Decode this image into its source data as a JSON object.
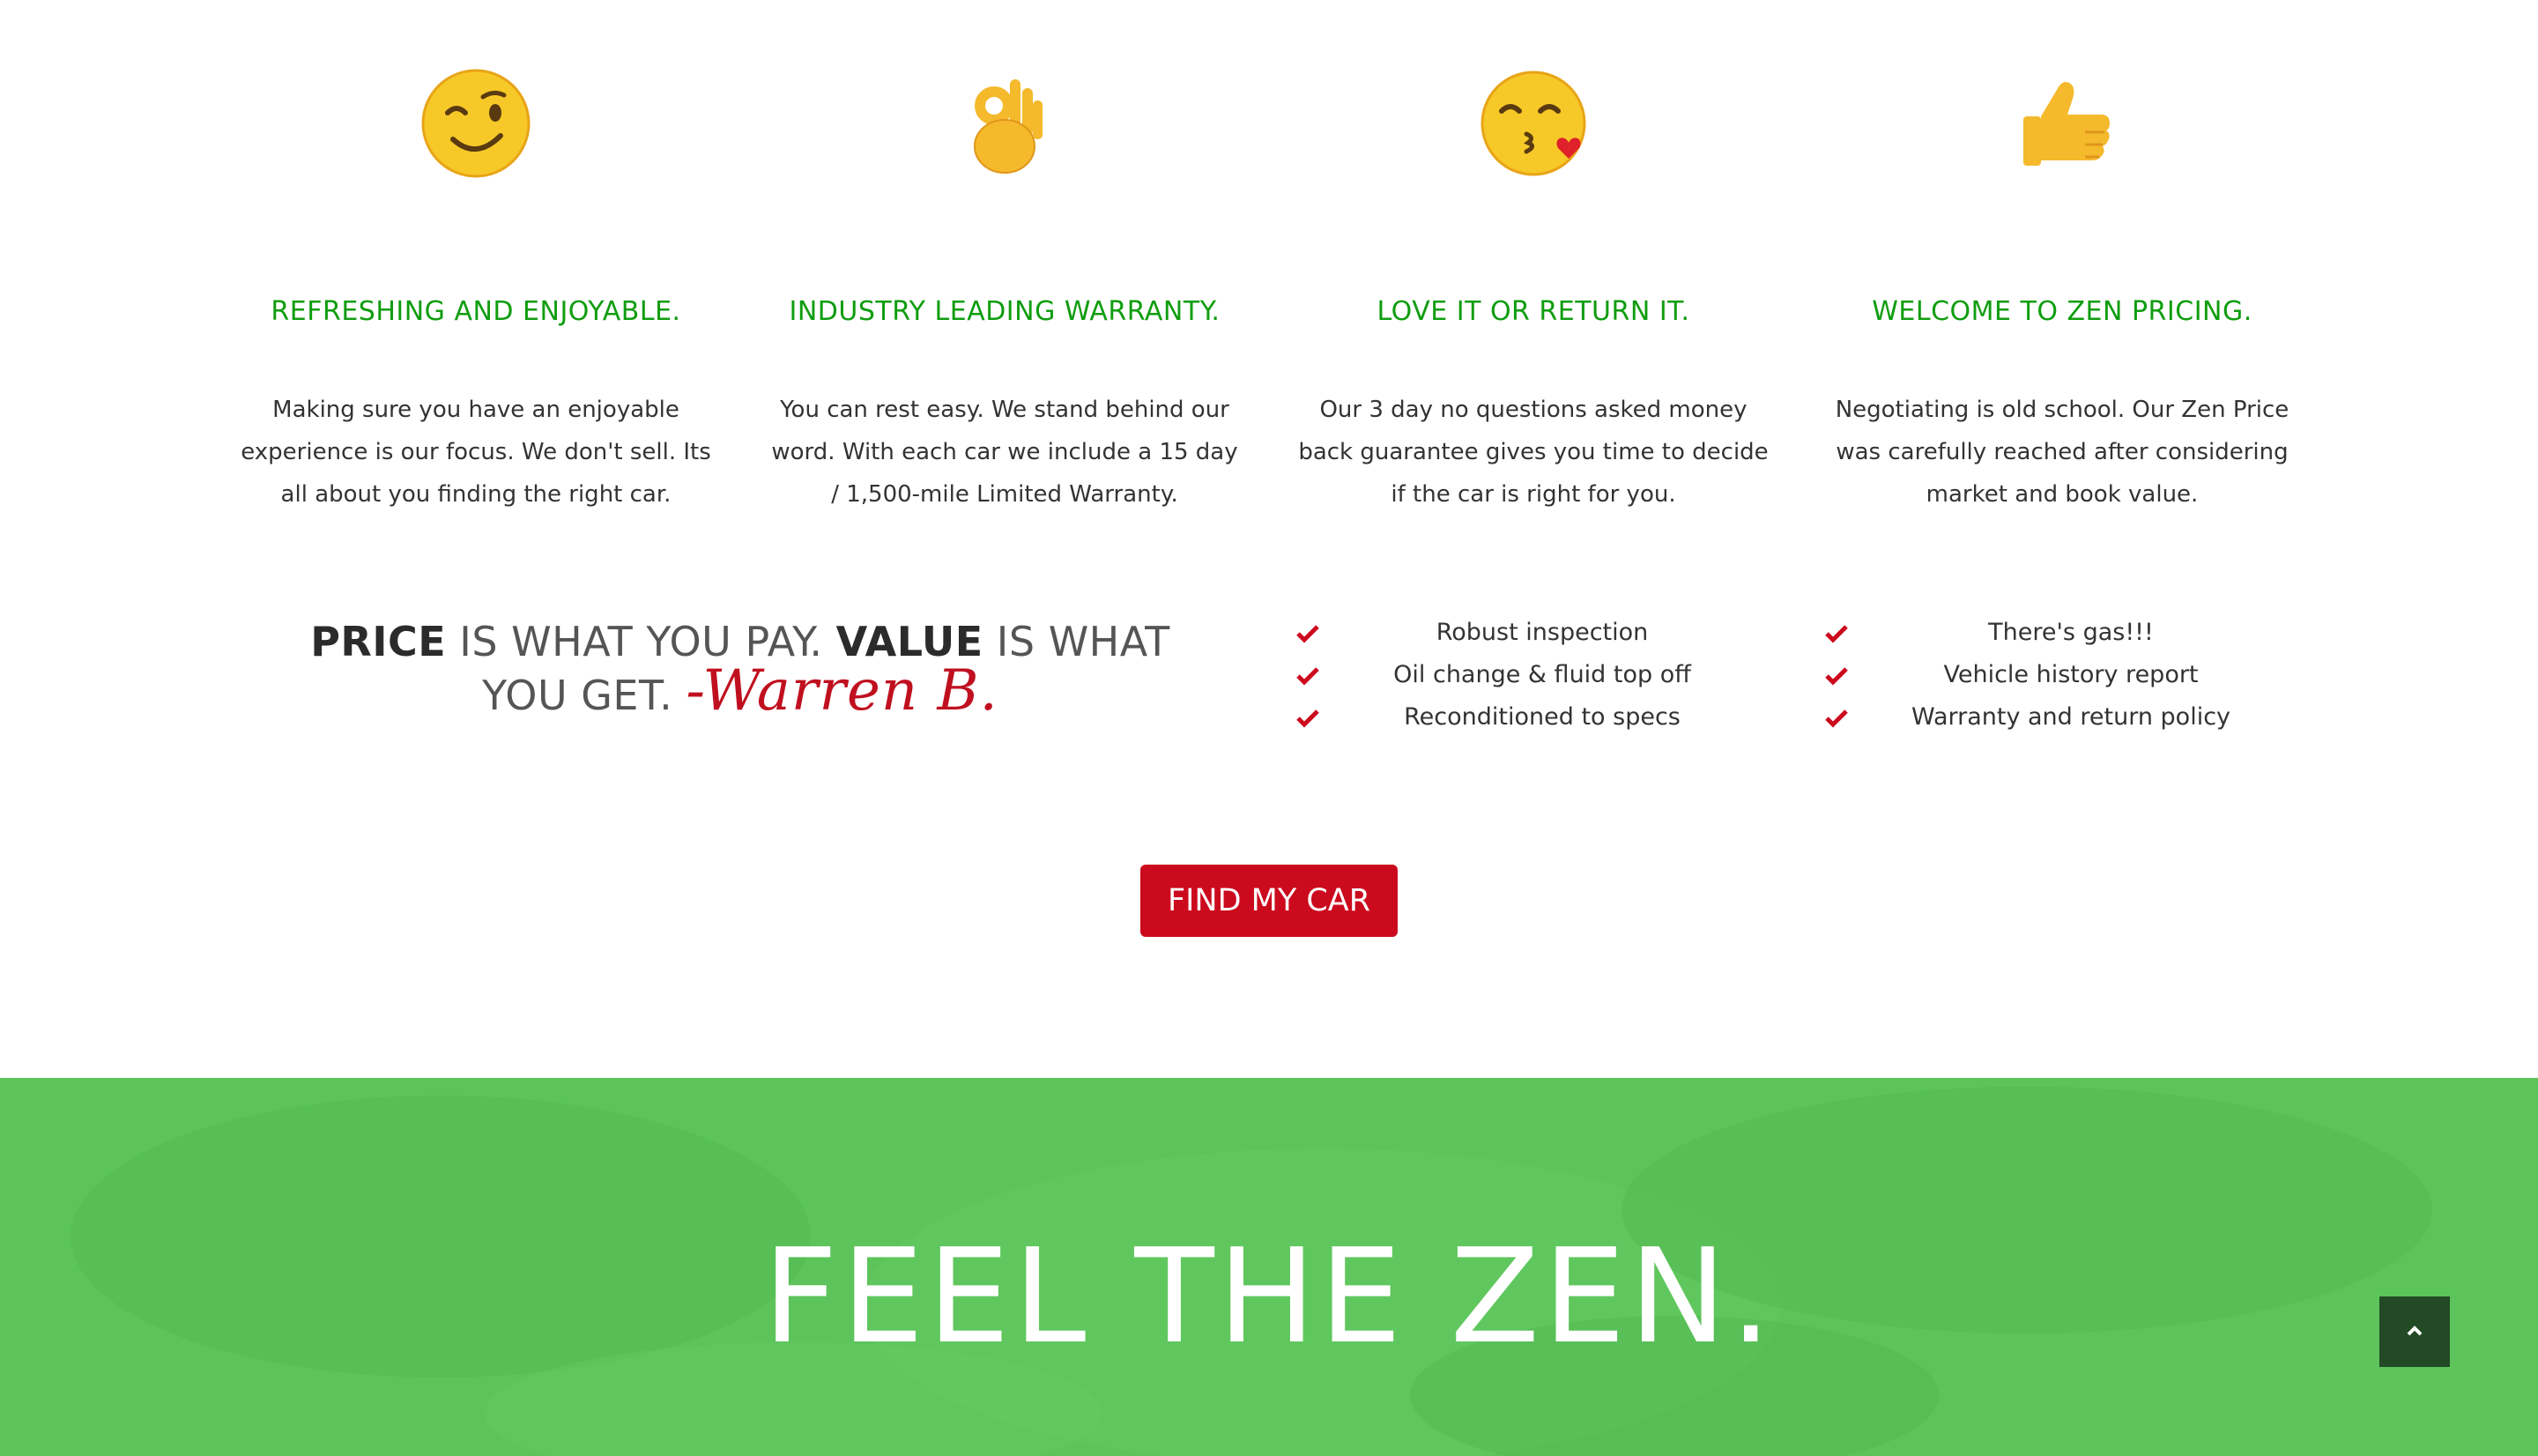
{
  "features": [
    {
      "icon": "winking-face-icon",
      "title": "REFRESHING AND ENJOYABLE.",
      "text": "Making sure you have an enjoyable experience is our focus. We don't sell. Its all about you finding the right car."
    },
    {
      "icon": "ok-hand-icon",
      "title": "INDUSTRY LEADING WARRANTY.",
      "text": "You can rest easy. We stand behind our word. With each car we include a 15 day / 1,500-mile Limited Warranty."
    },
    {
      "icon": "kissing-face-icon",
      "title": "LOVE IT OR RETURN IT.",
      "text": "Our 3 day no questions asked money back guarantee gives you time to decide if the car is right for you."
    },
    {
      "icon": "thumbs-up-icon",
      "title": "WELCOME TO ZEN PRICING.",
      "text": "Negotiating is old school. Our Zen Price was carefully reached after considering market and book value."
    }
  ],
  "quote": {
    "word1": "PRICE",
    "part1": " IS WHAT YOU PAY. ",
    "word2": "VALUE",
    "part2": " IS WHAT YOU GET. ",
    "signature": "-Warren B."
  },
  "checklist_left": [
    "Robust inspection",
    "Oil change & fluid top off",
    "Reconditioned to specs"
  ],
  "checklist_right": [
    "There's gas!!!",
    "Vehicle history report",
    "Warranty and return policy"
  ],
  "cta": {
    "label": "FIND MY CAR"
  },
  "banner": {
    "title": "FEEL THE ZEN."
  },
  "colors": {
    "accent_green": "#0f9d0f",
    "cta_red": "#cc0a1e",
    "banner_green": "#5cc45a",
    "to_top_bg": "#214a25"
  }
}
